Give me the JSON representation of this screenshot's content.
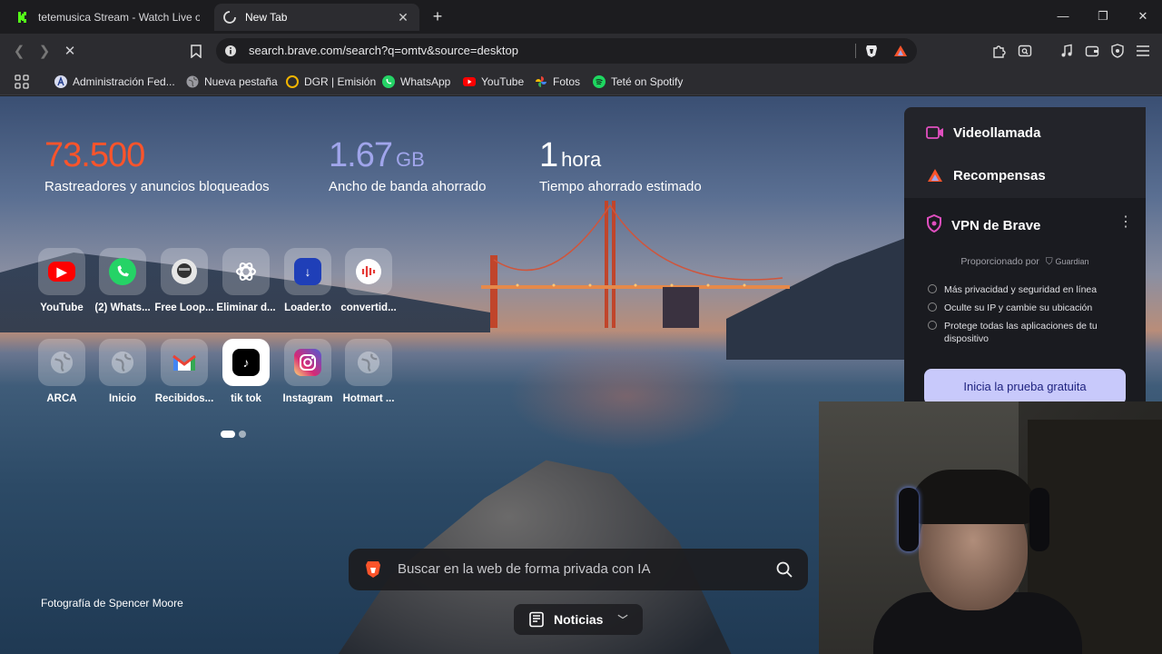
{
  "tabs": [
    {
      "title": "tetemusica Stream - Watch Live on K",
      "active": false
    },
    {
      "title": "New Tab",
      "active": true
    }
  ],
  "toolbar": {
    "url": "search.brave.com/search?q=omtv&source=desktop"
  },
  "bookmarks": [
    {
      "label": "Administración Fed...",
      "icon": "afip-icon"
    },
    {
      "label": "Nueva pestaña",
      "icon": "globe-icon"
    },
    {
      "label": "DGR | Emisión",
      "icon": "dgr-icon"
    },
    {
      "label": "WhatsApp",
      "icon": "whatsapp-icon"
    },
    {
      "label": "YouTube",
      "icon": "youtube-icon"
    },
    {
      "label": "Fotos",
      "icon": "photos-icon"
    },
    {
      "label": "Teté on Spotify",
      "icon": "spotify-icon"
    }
  ],
  "stats": [
    {
      "value": "73.500",
      "unit": "",
      "label": "Rastreadores y anuncios bloqueados",
      "color": "#fb542b"
    },
    {
      "value": "1.67",
      "unit": "GB",
      "label": "Ancho de banda ahorrado",
      "color": "#a0a5eb"
    },
    {
      "value": "1",
      "unit": "hora",
      "label": "Tiempo ahorrado estimado",
      "color": "#ffffff"
    }
  ],
  "top_sites": [
    {
      "label": "YouTube",
      "icon": "youtube-icon"
    },
    {
      "label": "(2) Whats...",
      "icon": "whatsapp-icon"
    },
    {
      "label": "Free Loop...",
      "icon": "loop-icon"
    },
    {
      "label": "Eliminar d...",
      "icon": "openai-icon"
    },
    {
      "label": "Loader.to",
      "icon": "loader-icon"
    },
    {
      "label": "convertid...",
      "icon": "converter-icon"
    },
    {
      "label": "ARCA",
      "icon": "globe-icon"
    },
    {
      "label": "Inicio",
      "icon": "globe-icon"
    },
    {
      "label": "Recibidos...",
      "icon": "gmail-icon"
    },
    {
      "label": "tik tok",
      "icon": "tiktok-icon"
    },
    {
      "label": "Instagram",
      "icon": "instagram-icon"
    },
    {
      "label": "Hotmart ...",
      "icon": "globe-icon"
    }
  ],
  "credit": "Fotografía de Spencer Moore",
  "search": {
    "placeholder": "Buscar en la web de forma privada con IA"
  },
  "news": {
    "label": "Noticias"
  },
  "widgets": {
    "videocall": "Videollamada",
    "rewards": "Recompensas",
    "vpn": {
      "title": "VPN de Brave",
      "provided_by": "Proporcionado por",
      "provider": "Guardian",
      "features": [
        "Más privacidad y seguridad en línea",
        "Oculte su IP y cambie su ubicación",
        "Protege todas las aplicaciones de tu dispositivo"
      ],
      "cta": "Inicia la prueba gratuita"
    }
  }
}
